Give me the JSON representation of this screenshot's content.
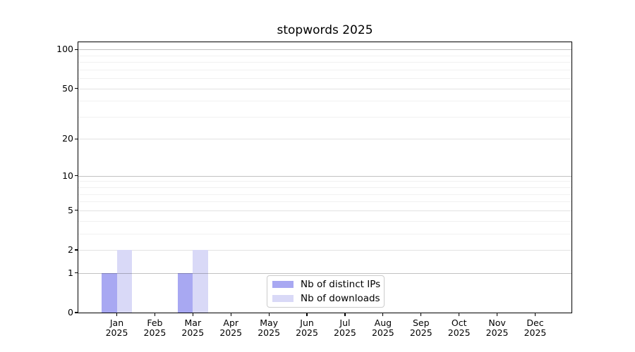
{
  "chart_data": {
    "type": "bar",
    "title": "stopwords 2025",
    "categories": [
      "Jan",
      "Feb",
      "Mar",
      "Apr",
      "May",
      "Jun",
      "Jul",
      "Aug",
      "Sep",
      "Oct",
      "Nov",
      "Dec"
    ],
    "category_year": "2025",
    "series": [
      {
        "name": "Nb of distinct IPs",
        "color": "#a8a8f2",
        "values": [
          1,
          0,
          1,
          0,
          0,
          0,
          0,
          0,
          0,
          0,
          0,
          0
        ]
      },
      {
        "name": "Nb of downloads",
        "color": "#d9d9f7",
        "values": [
          2,
          0,
          2,
          0,
          0,
          0,
          0,
          0,
          0,
          0,
          0,
          0
        ]
      }
    ],
    "y_axis": {
      "scale": "log1p",
      "ylim": [
        0,
        100
      ],
      "major_ticks": [
        0,
        1,
        2,
        5,
        10,
        20,
        50,
        100
      ],
      "power_gridlines": [
        1,
        10,
        100
      ],
      "minor_gridlines": [
        3,
        4,
        6,
        7,
        8,
        9,
        30,
        40,
        60,
        70,
        80,
        90
      ]
    },
    "grid": true,
    "legend": {
      "position": "bottom-center",
      "entries": [
        "Nb of distinct IPs",
        "Nb of downloads"
      ]
    },
    "colors": {
      "background": "#ffffff",
      "spine": "#000000",
      "text": "#000000",
      "grid_major": "#c2c2c2",
      "grid_mid": "#e2e2e2",
      "grid_minor": "#f1f1f1"
    }
  }
}
